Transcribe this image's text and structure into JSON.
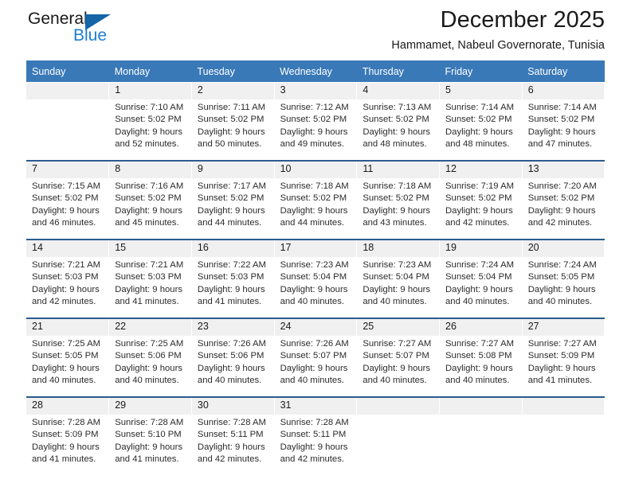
{
  "brand": {
    "word_one": "General",
    "word_two": "Blue",
    "triangle_color": "#1565a8",
    "blue_text_color": "#1b7ed1"
  },
  "header": {
    "title": "December 2025",
    "location": "Hammamet, Nabeul Governorate, Tunisia",
    "header_bg": "#3a79b8",
    "daynum_bg": "#f0f0f0",
    "row_divider": "#2b5c8f"
  },
  "calendar": {
    "weekday_headers": [
      "Sunday",
      "Monday",
      "Tuesday",
      "Wednesday",
      "Thursday",
      "Friday",
      "Saturday"
    ],
    "weeks": [
      [
        {
          "day": "",
          "sunrise": "",
          "sunset": "",
          "daylight_line1": "",
          "daylight_line2": ""
        },
        {
          "day": "1",
          "sunrise": "Sunrise: 7:10 AM",
          "sunset": "Sunset: 5:02 PM",
          "daylight_line1": "Daylight: 9 hours",
          "daylight_line2": "and 52 minutes."
        },
        {
          "day": "2",
          "sunrise": "Sunrise: 7:11 AM",
          "sunset": "Sunset: 5:02 PM",
          "daylight_line1": "Daylight: 9 hours",
          "daylight_line2": "and 50 minutes."
        },
        {
          "day": "3",
          "sunrise": "Sunrise: 7:12 AM",
          "sunset": "Sunset: 5:02 PM",
          "daylight_line1": "Daylight: 9 hours",
          "daylight_line2": "and 49 minutes."
        },
        {
          "day": "4",
          "sunrise": "Sunrise: 7:13 AM",
          "sunset": "Sunset: 5:02 PM",
          "daylight_line1": "Daylight: 9 hours",
          "daylight_line2": "and 48 minutes."
        },
        {
          "day": "5",
          "sunrise": "Sunrise: 7:14 AM",
          "sunset": "Sunset: 5:02 PM",
          "daylight_line1": "Daylight: 9 hours",
          "daylight_line2": "and 48 minutes."
        },
        {
          "day": "6",
          "sunrise": "Sunrise: 7:14 AM",
          "sunset": "Sunset: 5:02 PM",
          "daylight_line1": "Daylight: 9 hours",
          "daylight_line2": "and 47 minutes."
        }
      ],
      [
        {
          "day": "7",
          "sunrise": "Sunrise: 7:15 AM",
          "sunset": "Sunset: 5:02 PM",
          "daylight_line1": "Daylight: 9 hours",
          "daylight_line2": "and 46 minutes."
        },
        {
          "day": "8",
          "sunrise": "Sunrise: 7:16 AM",
          "sunset": "Sunset: 5:02 PM",
          "daylight_line1": "Daylight: 9 hours",
          "daylight_line2": "and 45 minutes."
        },
        {
          "day": "9",
          "sunrise": "Sunrise: 7:17 AM",
          "sunset": "Sunset: 5:02 PM",
          "daylight_line1": "Daylight: 9 hours",
          "daylight_line2": "and 44 minutes."
        },
        {
          "day": "10",
          "sunrise": "Sunrise: 7:18 AM",
          "sunset": "Sunset: 5:02 PM",
          "daylight_line1": "Daylight: 9 hours",
          "daylight_line2": "and 44 minutes."
        },
        {
          "day": "11",
          "sunrise": "Sunrise: 7:18 AM",
          "sunset": "Sunset: 5:02 PM",
          "daylight_line1": "Daylight: 9 hours",
          "daylight_line2": "and 43 minutes."
        },
        {
          "day": "12",
          "sunrise": "Sunrise: 7:19 AM",
          "sunset": "Sunset: 5:02 PM",
          "daylight_line1": "Daylight: 9 hours",
          "daylight_line2": "and 42 minutes."
        },
        {
          "day": "13",
          "sunrise": "Sunrise: 7:20 AM",
          "sunset": "Sunset: 5:02 PM",
          "daylight_line1": "Daylight: 9 hours",
          "daylight_line2": "and 42 minutes."
        }
      ],
      [
        {
          "day": "14",
          "sunrise": "Sunrise: 7:21 AM",
          "sunset": "Sunset: 5:03 PM",
          "daylight_line1": "Daylight: 9 hours",
          "daylight_line2": "and 42 minutes."
        },
        {
          "day": "15",
          "sunrise": "Sunrise: 7:21 AM",
          "sunset": "Sunset: 5:03 PM",
          "daylight_line1": "Daylight: 9 hours",
          "daylight_line2": "and 41 minutes."
        },
        {
          "day": "16",
          "sunrise": "Sunrise: 7:22 AM",
          "sunset": "Sunset: 5:03 PM",
          "daylight_line1": "Daylight: 9 hours",
          "daylight_line2": "and 41 minutes."
        },
        {
          "day": "17",
          "sunrise": "Sunrise: 7:23 AM",
          "sunset": "Sunset: 5:04 PM",
          "daylight_line1": "Daylight: 9 hours",
          "daylight_line2": "and 40 minutes."
        },
        {
          "day": "18",
          "sunrise": "Sunrise: 7:23 AM",
          "sunset": "Sunset: 5:04 PM",
          "daylight_line1": "Daylight: 9 hours",
          "daylight_line2": "and 40 minutes."
        },
        {
          "day": "19",
          "sunrise": "Sunrise: 7:24 AM",
          "sunset": "Sunset: 5:04 PM",
          "daylight_line1": "Daylight: 9 hours",
          "daylight_line2": "and 40 minutes."
        },
        {
          "day": "20",
          "sunrise": "Sunrise: 7:24 AM",
          "sunset": "Sunset: 5:05 PM",
          "daylight_line1": "Daylight: 9 hours",
          "daylight_line2": "and 40 minutes."
        }
      ],
      [
        {
          "day": "21",
          "sunrise": "Sunrise: 7:25 AM",
          "sunset": "Sunset: 5:05 PM",
          "daylight_line1": "Daylight: 9 hours",
          "daylight_line2": "and 40 minutes."
        },
        {
          "day": "22",
          "sunrise": "Sunrise: 7:25 AM",
          "sunset": "Sunset: 5:06 PM",
          "daylight_line1": "Daylight: 9 hours",
          "daylight_line2": "and 40 minutes."
        },
        {
          "day": "23",
          "sunrise": "Sunrise: 7:26 AM",
          "sunset": "Sunset: 5:06 PM",
          "daylight_line1": "Daylight: 9 hours",
          "daylight_line2": "and 40 minutes."
        },
        {
          "day": "24",
          "sunrise": "Sunrise: 7:26 AM",
          "sunset": "Sunset: 5:07 PM",
          "daylight_line1": "Daylight: 9 hours",
          "daylight_line2": "and 40 minutes."
        },
        {
          "day": "25",
          "sunrise": "Sunrise: 7:27 AM",
          "sunset": "Sunset: 5:07 PM",
          "daylight_line1": "Daylight: 9 hours",
          "daylight_line2": "and 40 minutes."
        },
        {
          "day": "26",
          "sunrise": "Sunrise: 7:27 AM",
          "sunset": "Sunset: 5:08 PM",
          "daylight_line1": "Daylight: 9 hours",
          "daylight_line2": "and 40 minutes."
        },
        {
          "day": "27",
          "sunrise": "Sunrise: 7:27 AM",
          "sunset": "Sunset: 5:09 PM",
          "daylight_line1": "Daylight: 9 hours",
          "daylight_line2": "and 41 minutes."
        }
      ],
      [
        {
          "day": "28",
          "sunrise": "Sunrise: 7:28 AM",
          "sunset": "Sunset: 5:09 PM",
          "daylight_line1": "Daylight: 9 hours",
          "daylight_line2": "and 41 minutes."
        },
        {
          "day": "29",
          "sunrise": "Sunrise: 7:28 AM",
          "sunset": "Sunset: 5:10 PM",
          "daylight_line1": "Daylight: 9 hours",
          "daylight_line2": "and 41 minutes."
        },
        {
          "day": "30",
          "sunrise": "Sunrise: 7:28 AM",
          "sunset": "Sunset: 5:11 PM",
          "daylight_line1": "Daylight: 9 hours",
          "daylight_line2": "and 42 minutes."
        },
        {
          "day": "31",
          "sunrise": "Sunrise: 7:28 AM",
          "sunset": "Sunset: 5:11 PM",
          "daylight_line1": "Daylight: 9 hours",
          "daylight_line2": "and 42 minutes."
        },
        {
          "day": "",
          "sunrise": "",
          "sunset": "",
          "daylight_line1": "",
          "daylight_line2": ""
        },
        {
          "day": "",
          "sunrise": "",
          "sunset": "",
          "daylight_line1": "",
          "daylight_line2": ""
        },
        {
          "day": "",
          "sunrise": "",
          "sunset": "",
          "daylight_line1": "",
          "daylight_line2": ""
        }
      ]
    ]
  }
}
